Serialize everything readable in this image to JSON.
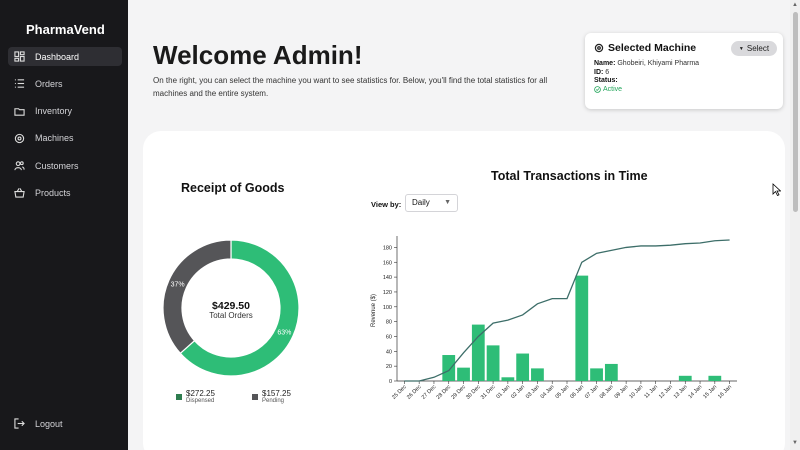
{
  "sidebar": {
    "brand": "PharmaVend",
    "items": [
      {
        "label": "Dashboard",
        "icon": "dashboard-icon",
        "active": true
      },
      {
        "label": "Orders",
        "icon": "list-icon"
      },
      {
        "label": "Inventory",
        "icon": "folder-icon"
      },
      {
        "label": "Machines",
        "icon": "gear-icon"
      },
      {
        "label": "Customers",
        "icon": "users-icon"
      },
      {
        "label": "Products",
        "icon": "basket-icon"
      }
    ],
    "logout": "Logout"
  },
  "header": {
    "title": "Welcome Admin!",
    "intro": "On the right, you can select the machine you want to see statistics for. Below, you'll find the total statistics for all machines and the entire system."
  },
  "machine": {
    "title": "Selected Machine",
    "select_label": "Select",
    "name_label": "Name:",
    "name_value": "Ghobeiri, Khiyami Pharma",
    "id_label": "ID:",
    "id_value": "6",
    "status_label": "Status:",
    "status_value": "Active",
    "status_color": "#22a55a"
  },
  "receipt": {
    "title": "Receipt of Goods",
    "total_value": "$429.50",
    "total_label": "Total Orders",
    "legend": [
      {
        "value": "$272.25",
        "name": "Dispensed",
        "color": "#2ebd77"
      },
      {
        "value": "$157.25",
        "name": "Pending",
        "color": "#555558"
      }
    ]
  },
  "transactions": {
    "title": "Total Transactions in Time",
    "view_by_label": "View by:",
    "view_by_value": "Daily"
  },
  "chart_data": [
    {
      "type": "pie",
      "slices": [
        {
          "name": "Dispensed",
          "value": 272.25,
          "pct_label": "63%",
          "color": "#2ebd77"
        },
        {
          "name": "Pending",
          "value": 157.25,
          "pct_label": "37%",
          "color": "#555558"
        }
      ]
    },
    {
      "type": "bar",
      "categories": [
        "25 Dec",
        "26 Dec",
        "27 Dec",
        "28 Dec",
        "29 Dec",
        "30 Dec",
        "31 Dec",
        "01 Jan",
        "02 Jan",
        "03 Jan",
        "04 Jan",
        "05 Jan",
        "06 Jan",
        "07 Jan",
        "08 Jan",
        "09 Jan",
        "10 Jan",
        "11 Jan",
        "12 Jan",
        "13 Jan",
        "14 Jan",
        "15 Jan",
        "16 Jan"
      ],
      "values": [
        0,
        0,
        0,
        35,
        18,
        76,
        48,
        5,
        37,
        17,
        0,
        0,
        142,
        17,
        23,
        0,
        0,
        0,
        0,
        7,
        0,
        7,
        0
      ],
      "cumulative_line": [
        0,
        0,
        5,
        14,
        38,
        60,
        78,
        82,
        89,
        104,
        111,
        111,
        160,
        172,
        176,
        180,
        182,
        182,
        183,
        185,
        186,
        189,
        190
      ],
      "ylabel": "Revenue ($)",
      "ylim": [
        0,
        190
      ],
      "yticks": [
        0,
        20,
        40,
        60,
        80,
        100,
        120,
        140,
        160,
        180
      ],
      "bar_color": "#2ebd77",
      "line_color": "#3d6e69"
    }
  ]
}
